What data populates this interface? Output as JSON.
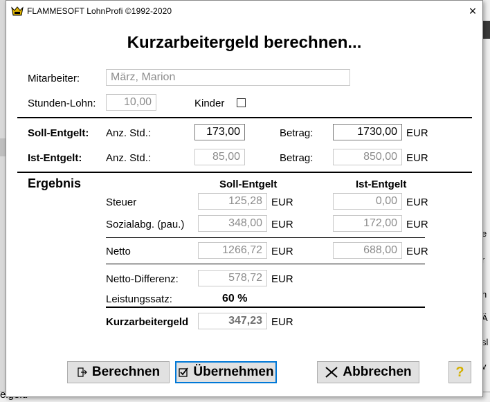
{
  "background": {
    "right_fragments": [
      "e",
      "r",
      "h",
      "Ä",
      "sl",
      "v"
    ],
    "bottom_fragment": "elgeld"
  },
  "dialog": {
    "title": "FLAMMESOFT LohnProfi   ©1992-2020",
    "close_glyph": "×",
    "heading": "Kurzarbeitergeld berechnen..."
  },
  "employee": {
    "label": "Mitarbeiter:",
    "value": "März, Marion"
  },
  "hourly_wage": {
    "label": "Stunden-Lohn:",
    "value": "10,00"
  },
  "children": {
    "label": "Kinder",
    "checked": false
  },
  "soll": {
    "label": "Soll-Entgelt:",
    "hours_label": "Anz. Std.:",
    "hours": "173,00",
    "amount_label": "Betrag:",
    "amount": "1730,00",
    "currency": "EUR"
  },
  "ist": {
    "label": "Ist-Entgelt:",
    "hours_label": "Anz. Std.:",
    "hours": "85,00",
    "amount_label": "Betrag:",
    "amount": "850,00",
    "currency": "EUR"
  },
  "result": {
    "title": "Ergebnis",
    "col_soll": "Soll-Entgelt",
    "col_ist": "Ist-Entgelt",
    "tax_label": "Steuer",
    "tax_soll": "125,28",
    "tax_ist": "0,00",
    "social_label": "Sozialabg. (pau.)",
    "social_soll": "348,00",
    "social_ist": "172,00",
    "net_label": "Netto",
    "net_soll": "1266,72",
    "net_ist": "688,00",
    "net_diff_label": "Netto-Differenz:",
    "net_diff": "578,72",
    "rate_label": "Leistungssatz:",
    "rate": "60 %",
    "kug_label": "Kurzarbeitergeld",
    "kug": "347,23",
    "currency": "EUR"
  },
  "buttons": {
    "calculate": "Berechnen",
    "apply": "Übernehmen",
    "cancel": "Abbrechen",
    "help": "?"
  },
  "colors": {
    "help_icon": "#d4b000",
    "focus_border": "#0078d7"
  }
}
